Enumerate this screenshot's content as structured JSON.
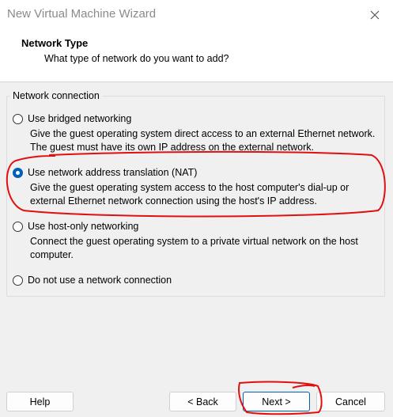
{
  "window": {
    "title": "New Virtual Machine Wizard",
    "close_icon": "close-icon"
  },
  "header": {
    "title": "Network Type",
    "subtitle": "What type of network do you want to add?"
  },
  "network_group": {
    "legend": "Network connection",
    "options": [
      {
        "label": "Use bridged networking",
        "description": "Give the guest operating system direct access to an external Ethernet network. The guest must have its own IP address on the external network.",
        "selected": false
      },
      {
        "label": "Use network address translation (NAT)",
        "description": "Give the guest operating system access to the host computer's dial-up or external Ethernet network connection using the host's IP address.",
        "selected": true
      },
      {
        "label": "Use host-only networking",
        "description": "Connect the guest operating system to a private virtual network on the host computer.",
        "selected": false
      },
      {
        "label": "Do not use a network connection",
        "description": "",
        "selected": false
      }
    ]
  },
  "buttons": {
    "help": "Help",
    "back": "< Back",
    "next": "Next >",
    "cancel": "Cancel"
  },
  "colors": {
    "accent": "#005fb8",
    "annotation": "#e01010"
  }
}
